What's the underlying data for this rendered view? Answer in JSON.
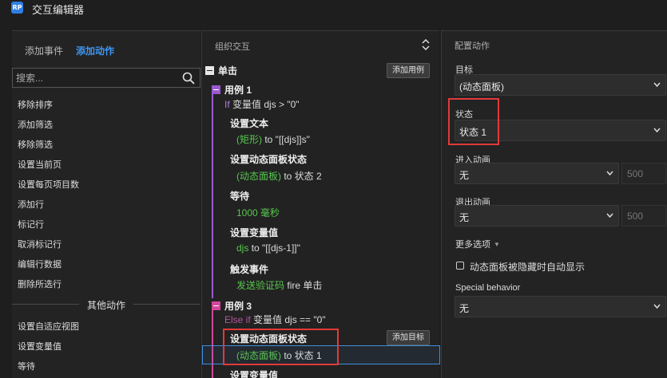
{
  "window": {
    "logo_text": "RP",
    "title": "交互编辑器"
  },
  "left": {
    "tabs": {
      "events": "添加事件",
      "actions": "添加动作"
    },
    "search": {
      "placeholder": "搜索..."
    },
    "items": [
      "移除排序",
      "添加筛选",
      "移除筛选",
      "设置当前页",
      "设置每页项目数",
      "添加行",
      "标记行",
      "取消标记行",
      "编辑行数据",
      "删除所选行"
    ],
    "section_title": "其他动作",
    "other_items": [
      "设置自适应视图",
      "设置变量值",
      "等待"
    ]
  },
  "middle": {
    "header": "组织交互",
    "event": {
      "label": "单击",
      "add_case_button": "添加用例"
    },
    "case1": {
      "label": "用例 1",
      "condition_kw": "If",
      "condition_text": "变量值 djs > \"0\"",
      "actions": [
        {
          "title": "设置文本",
          "target": "(矩形)",
          "detail": "to \"[[djs]]s\""
        },
        {
          "title": "设置动态面板状态",
          "target": "(动态面板)",
          "detail": "to 状态 2"
        },
        {
          "title": "等待",
          "target": "1000 毫秒",
          "detail": ""
        },
        {
          "title": "设置变量值",
          "target": "djs",
          "detail": "to \"[[djs-1]]\""
        },
        {
          "title": "触发事件",
          "target": "发送验证码",
          "detail": "fire 单击"
        }
      ]
    },
    "case3": {
      "label": "用例 3",
      "condition_kw": "Else if",
      "condition_text": "变量值 djs == \"0\"",
      "add_target_button": "添加目标",
      "actions": [
        {
          "title": "设置动态面板状态",
          "target": "(动态面板)",
          "detail": "to 状态 1"
        },
        {
          "title": "设置变量值",
          "target": "",
          "detail": ""
        }
      ]
    }
  },
  "right": {
    "header": "配置动作",
    "target_label": "目标",
    "target_value": "(动态面板)",
    "state_label": "状态",
    "state_value": "状态 1",
    "enter_anim_label": "进入动画",
    "enter_anim_value": "无",
    "enter_anim_ms": "500",
    "exit_anim_label": "退出动画",
    "exit_anim_value": "无",
    "exit_anim_ms": "500",
    "more_options": "更多选项",
    "auto_show_label": "动态面板被隐藏时自动显示",
    "auto_show_checked": false,
    "special_behavior_label": "Special behavior",
    "special_behavior_value": "无"
  },
  "colors": {
    "accent_blue": "#3d97f3",
    "highlight_red": "#e23a3a",
    "case1_purple": "#9b59d0",
    "case3_pink": "#d2479b",
    "target_green": "#58c750"
  }
}
